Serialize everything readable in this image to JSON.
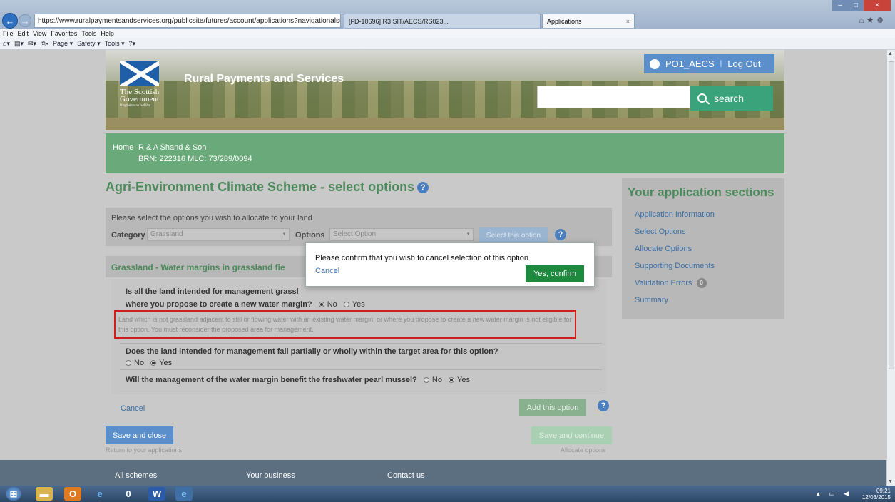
{
  "browser": {
    "address": "https://www.ruralpaymentsandservices.org/publicsite/futures/account/applications?navigationalstate=JBPNS_rO0ABXejABBfanNmQnJpZGdlVmll",
    "tabs": [
      {
        "label": "[FD-10696] R3 SIT/AECS/RS023..."
      },
      {
        "label": "Applications"
      }
    ],
    "menu": [
      "File",
      "Edit",
      "View",
      "Favorites",
      "Tools",
      "Help"
    ],
    "commands": [
      "Page ▾",
      "Safety ▾",
      "Tools ▾"
    ]
  },
  "header": {
    "logo_line1": "The Scottish",
    "logo_line2": "Government",
    "logo_line3": "Riaghaltas na h-Alba",
    "site_title": "Rural Payments and Services",
    "user": "PO1_AECS",
    "logout": "Log Out",
    "search_label": "search"
  },
  "nav": {
    "home": "Home",
    "farm": "R & A Shand & Son",
    "brn": "BRN: 222316 MLC: 73/289/0094"
  },
  "page": {
    "title": "Agri-Environment Climate Scheme - select options",
    "intro": "Please select the options you wish to allocate to your land",
    "category_label": "Category",
    "category_value": "Grassland",
    "options_label": "Options",
    "options_placeholder": "Select Option",
    "select_button": "Select this option",
    "option_header": "Grassland - Water margins in grassland fie",
    "q1_part1": "Is all the land intended for management grassl",
    "q1_part2": "where you propose to create a new water margin?",
    "q1_no": "No",
    "q1_yes": "Yes",
    "warning": "Land which is not grassland adjacent to still or flowing water with an existing water margin, or where you propose to create a new water margin is not eligible for this option. You must reconsider the proposed area for management.",
    "q2": "Does the land intended for management fall partially or wholly within the target area for this option?",
    "q2_no": "No",
    "q2_yes": "Yes",
    "q3": "Will the management of the water margin benefit the freshwater pearl mussel?",
    "q3_no": "No",
    "q3_yes": "Yes",
    "cancel": "Cancel",
    "add_option": "Add this option",
    "save_close": "Save and close",
    "save_close_sub": "Return to your applications",
    "save_continue": "Save and continue",
    "save_continue_sub": "Allocate options"
  },
  "sidebar": {
    "title": "Your application sections",
    "items": [
      {
        "label": "Application Information"
      },
      {
        "label": "Select Options"
      },
      {
        "label": "Allocate Options"
      },
      {
        "label": "Supporting Documents"
      },
      {
        "label": "Validation Errors",
        "badge": "0"
      },
      {
        "label": "Summary"
      }
    ]
  },
  "modal": {
    "message": "Please confirm that you wish to cancel selection of this option",
    "cancel": "Cancel",
    "confirm": "Yes, confirm"
  },
  "footer": {
    "links": [
      "All schemes",
      "Your business",
      "Contact us"
    ]
  },
  "taskbar": {
    "time": "09:21",
    "date": "12/03/2015"
  },
  "colors": {
    "brand_green": "#6aaa7a",
    "link_blue": "#3b6fa6",
    "confirm_green": "#1e8a3d",
    "warning_red": "#d01e1e"
  }
}
